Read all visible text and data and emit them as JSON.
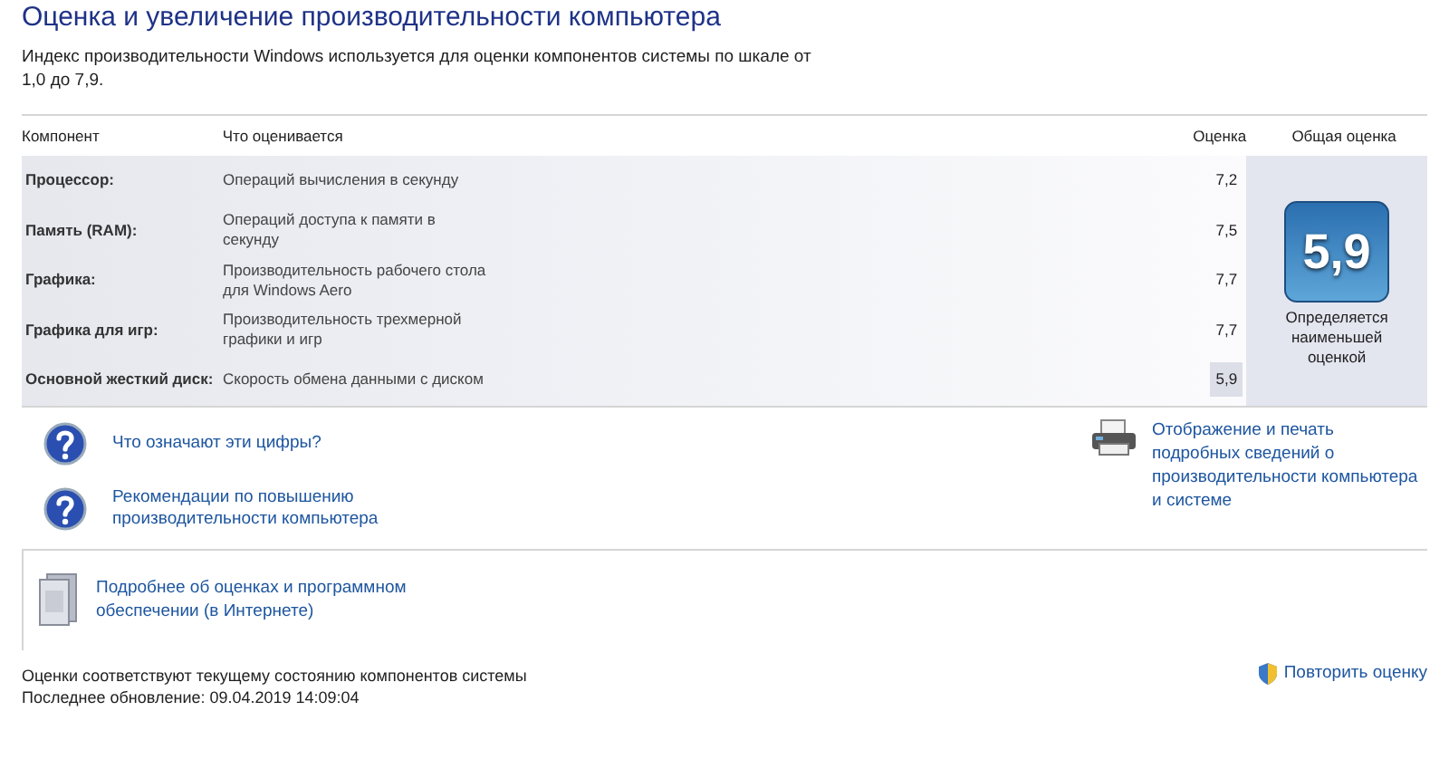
{
  "title": "Оценка и увеличение производительности компьютера",
  "description": "Индекс производительности Windows используется для оценки компонентов системы по шкале от 1,0 до 7,9.",
  "table": {
    "columns": [
      "Компонент",
      "Что оценивается",
      "Оценка",
      "Общая оценка"
    ],
    "rows": [
      {
        "component": "Процессор:",
        "measures": "Операций вычисления в секунду",
        "score": "7,2",
        "lowest": false
      },
      {
        "component": "Память (RAM):",
        "measures": "Операций доступа к памяти в секунду",
        "score": "7,5",
        "lowest": false
      },
      {
        "component": "Графика:",
        "measures": "Производительность рабочего стола для Windows Aero",
        "score": "7,7",
        "lowest": false
      },
      {
        "component": "Графика для игр:",
        "measures": "Производительность трехмерной графики и игр",
        "score": "7,7",
        "lowest": false
      },
      {
        "component": "Основной жесткий диск:",
        "measures": "Скорость обмена данными с диском",
        "score": "5,9",
        "lowest": true
      }
    ],
    "base_score": "5,9",
    "base_note": "Определяется наименьшей оценкой"
  },
  "help_links": [
    "Что означают эти цифры?",
    "Рекомендации по повышению производительности компьютера"
  ],
  "print_link": "Отображение и печать подробных сведений о производительности компьютера и системе",
  "online_link": "Подробнее об оценках и программном обеспечении (в Интернете)",
  "status": [
    "Оценки соответствуют текущему состоянию компонентов системы",
    "Последнее обновление: 09.04.2019 14:09:04"
  ],
  "rerun_link": "Повторить оценку"
}
